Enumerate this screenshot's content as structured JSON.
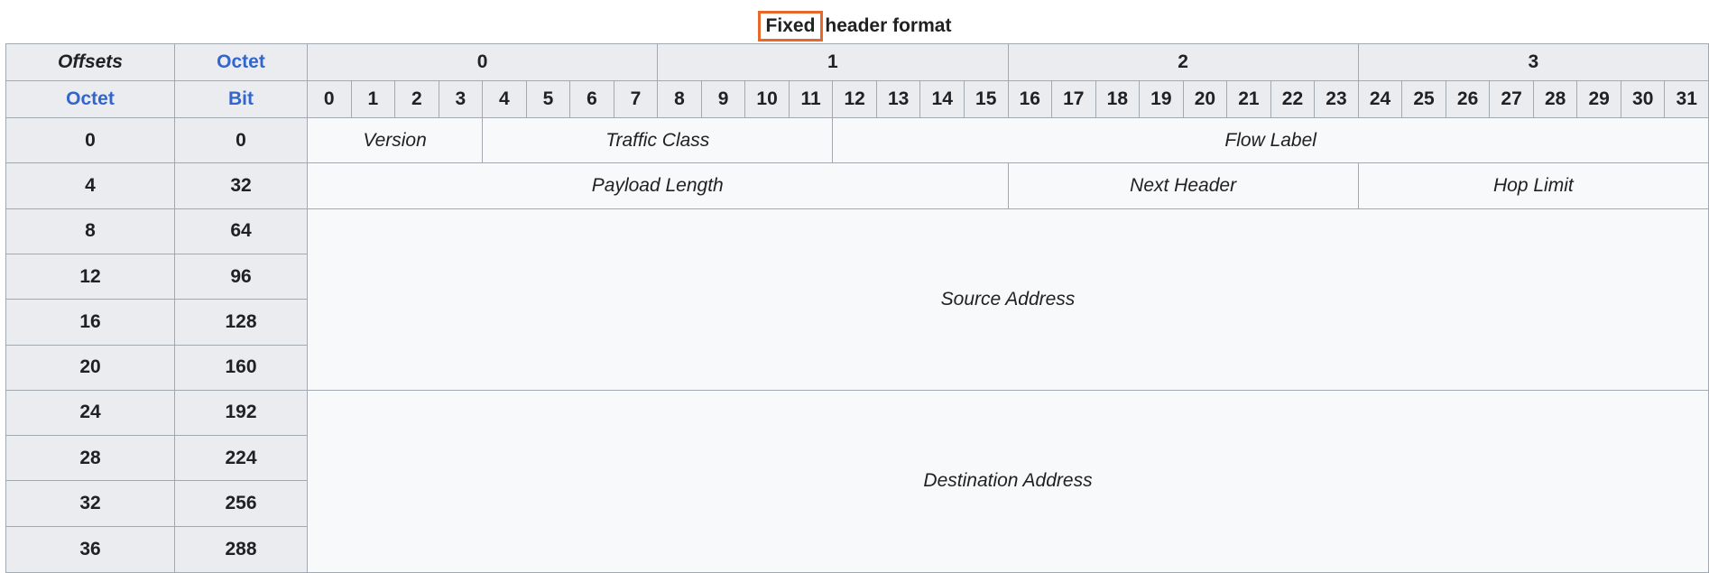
{
  "caption": {
    "highlight": "Fixed",
    "rest": "header format"
  },
  "header": {
    "offsets": "Offsets",
    "octet": "Octet",
    "octet_col": "Octet",
    "bit_col": "Bit",
    "octets": [
      "0",
      "1",
      "2",
      "3"
    ],
    "bits": [
      "0",
      "1",
      "2",
      "3",
      "4",
      "5",
      "6",
      "7",
      "8",
      "9",
      "10",
      "11",
      "12",
      "13",
      "14",
      "15",
      "16",
      "17",
      "18",
      "19",
      "20",
      "21",
      "22",
      "23",
      "24",
      "25",
      "26",
      "27",
      "28",
      "29",
      "30",
      "31"
    ]
  },
  "rows": [
    {
      "octet": "0",
      "bit": "0"
    },
    {
      "octet": "4",
      "bit": "32"
    },
    {
      "octet": "8",
      "bit": "64"
    },
    {
      "octet": "12",
      "bit": "96"
    },
    {
      "octet": "16",
      "bit": "128"
    },
    {
      "octet": "20",
      "bit": "160"
    },
    {
      "octet": "24",
      "bit": "192"
    },
    {
      "octet": "28",
      "bit": "224"
    },
    {
      "octet": "32",
      "bit": "256"
    },
    {
      "octet": "36",
      "bit": "288"
    }
  ],
  "fields": {
    "version": "Version",
    "traffic_class": "Traffic Class",
    "flow_label": "Flow Label",
    "payload_length": "Payload Length",
    "next_header": "Next Header",
    "hop_limit": "Hop Limit",
    "source_address": "Source Address",
    "destination_address": "Destination Address"
  }
}
